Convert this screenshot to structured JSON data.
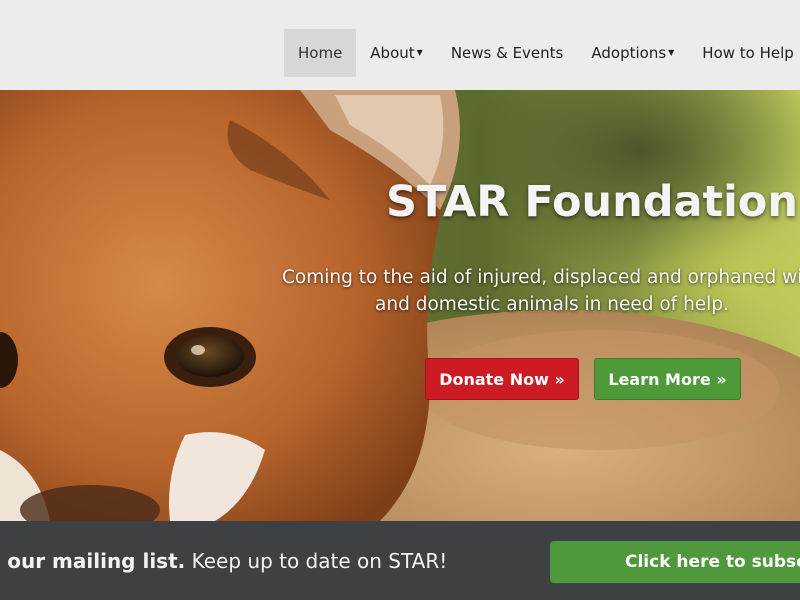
{
  "nav": {
    "items": [
      {
        "label": "Home",
        "active": true
      },
      {
        "label": "About",
        "dropdown": true
      },
      {
        "label": "News & Events",
        "dropdown": false
      },
      {
        "label": "Adoptions",
        "dropdown": true
      },
      {
        "label": "How to Help",
        "dropdown": false
      }
    ]
  },
  "hero": {
    "title": "STAR Foundation",
    "tagline_line1": "Coming to the aid of injured, displaced and orphaned wildlife",
    "tagline_line2": "and domestic animals in need of help.",
    "donate_label": "Donate Now »",
    "learn_label": "Learn More »",
    "image_subject": "fox-kit-photo"
  },
  "mailing": {
    "bold": "Join our mailing list.",
    "text": " Keep up to date on STAR!",
    "subscribe_label": "Click here to subscribe"
  },
  "colors": {
    "donate": "#cc1b22",
    "learn": "#4e9a39",
    "bar": "#3e4143",
    "nav_bg": "#ececec"
  }
}
